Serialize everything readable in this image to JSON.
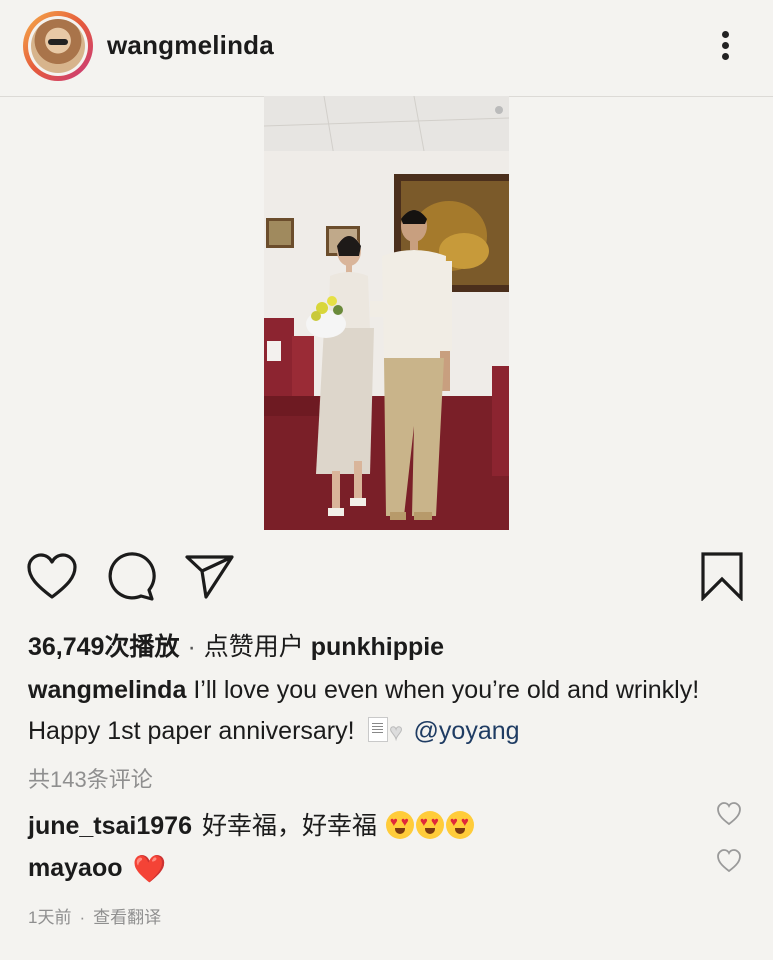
{
  "header": {
    "username": "wangmelinda"
  },
  "post": {
    "views": "36,749次播放",
    "liked_by_prefix": "点赞用户",
    "liked_by_user": "punkhippie",
    "caption_user": "wangmelinda",
    "caption_text": "I’ll love you even when you’re old and wrinkly! Happy 1st paper anniversary!",
    "caption_mention": "@yoyang",
    "comments_count": "共143条评论"
  },
  "comments": [
    {
      "user": "june_tsai1976",
      "text": "好幸福，好幸福"
    },
    {
      "user": "mayaoo",
      "text": "❤️"
    }
  ],
  "footer": {
    "time": "1天前",
    "translate": "查看翻译"
  },
  "icons": {
    "like": "heart-outline-icon",
    "comment": "comment-bubble-icon",
    "share": "send-arrow-icon",
    "save": "bookmark-icon",
    "more": "vertical-dots-icon"
  },
  "colors": {
    "background": "#f4f3f0",
    "mention": "#1f3c63",
    "secondary_text": "#8f8f8f",
    "avatar_ring_start": "#f6b04a",
    "avatar_ring_end": "#c7377f"
  }
}
